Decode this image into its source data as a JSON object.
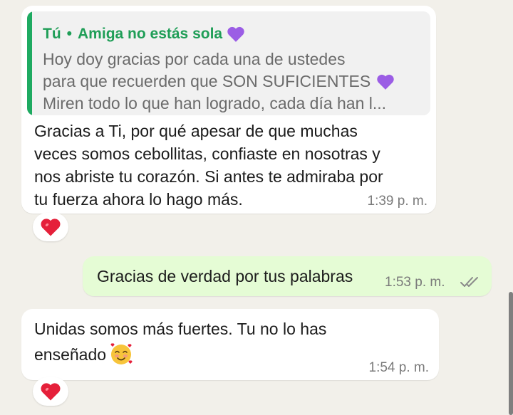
{
  "messages": [
    {
      "direction": "incoming",
      "quoted": {
        "author": "Tú",
        "separator": "•",
        "title": "Amiga no estás sola",
        "lines": [
          "Hoy doy gracias por cada una de ustedes",
          "para que recuerden que SON SUFICIENTES",
          "Miren todo lo que han logrado, cada día han l..."
        ]
      },
      "text_lines": [
        "Gracias a Ti, por qué apesar de que muchas",
        "veces somos cebollitas, confiaste en nosotras y",
        "nos abriste tu corazón. Si antes te admiraba por",
        "tu fuerza ahora lo hago más."
      ],
      "time": "1:39 p. m.",
      "reaction": "red-heart-icon"
    },
    {
      "direction": "outgoing",
      "text": "Gracias de verdad por tus palabras",
      "time": "1:53 p. m.",
      "status": "read-double-check-icon"
    },
    {
      "direction": "incoming",
      "text_lines": [
        "Unidas somos más fuertes. Tu no lo has",
        "enseñado"
      ],
      "emoji": "smiling-face-with-hearts-icon",
      "time": "1:54 p. m.",
      "reaction": "red-heart-icon"
    }
  ],
  "colors": {
    "background": "#f2f0ea",
    "incoming_bubble": "#ffffff",
    "outgoing_bubble": "#e5fcd5",
    "quote_accent": "#1eaa61",
    "read_ticks": "#8a8a8a",
    "heart": "#e5203a",
    "purple_heart": "#9b5de5"
  }
}
